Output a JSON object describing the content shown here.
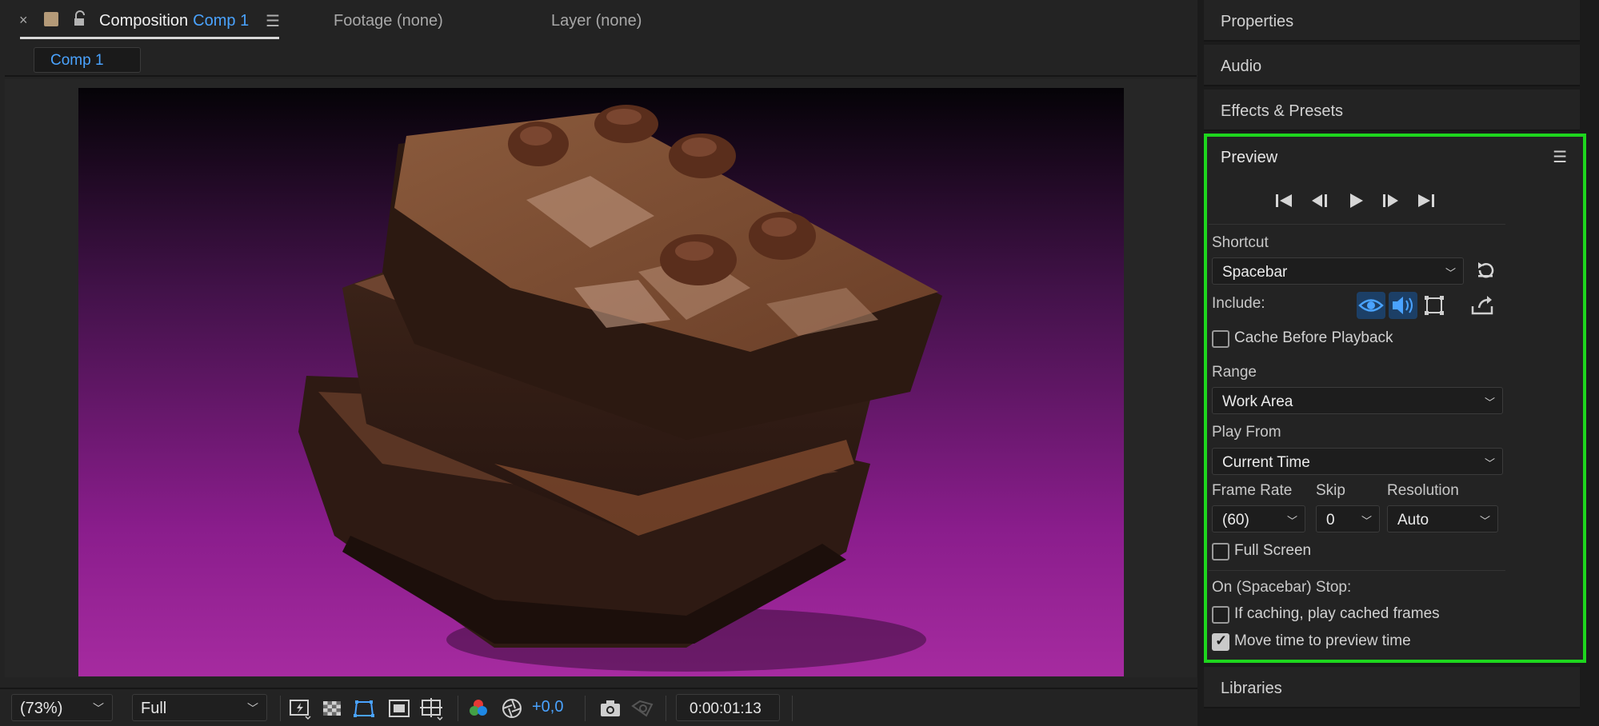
{
  "composition_panel": {
    "tab": {
      "close_glyph": "×",
      "swatch_color": "#b49a78",
      "title_prefix": "Composition",
      "comp_name": "Comp 1",
      "menu_glyph": "☰"
    },
    "footage_tab": "Footage (none)",
    "layer_tab": "Layer (none)",
    "flowchart_chip": "Comp 1",
    "viewer_image": "brownie-stack-on-magenta-background"
  },
  "viewer_toolbar": {
    "zoom": "(73%)",
    "resolution": "Full",
    "exposure": "+0,0",
    "current_time": "0:00:01:13",
    "icons": [
      "fast-previews-icon",
      "transparency-grid-icon",
      "mask-visibility-icon",
      "region-of-interest-icon",
      "grid-guides-icon",
      "color-channels-icon",
      "reset-exposure-icon",
      "snapshot-icon",
      "show-snapshot-icon"
    ]
  },
  "side_panels": {
    "properties": "Properties",
    "audio": "Audio",
    "effects_presets": "Effects & Presets",
    "libraries": "Libraries"
  },
  "preview": {
    "title": "Preview",
    "menu_glyph": "☰",
    "transport": [
      "first-frame-icon",
      "previous-frame-icon",
      "play-icon",
      "next-frame-icon",
      "last-frame-icon"
    ],
    "shortcut_label": "Shortcut",
    "shortcut_value": "Spacebar",
    "include_label": "Include:",
    "cache_before_playback": {
      "label": "Cache Before Playback",
      "checked": false
    },
    "range_label": "Range",
    "range_value": "Work Area",
    "play_from_label": "Play From",
    "play_from_value": "Current Time",
    "frame_rate_label": "Frame Rate",
    "frame_rate_value": "(60)",
    "skip_label": "Skip",
    "skip_value": "0",
    "resolution_label": "Resolution",
    "resolution_value": "Auto",
    "full_screen": {
      "label": "Full Screen",
      "checked": false
    },
    "on_stop_label": "On (Spacebar) Stop:",
    "if_caching": {
      "label": "If caching, play cached frames",
      "checked": false
    },
    "move_time": {
      "label": "Move time to preview time",
      "checked": true
    }
  },
  "colors": {
    "accent_blue": "#4aa3ff",
    "highlight_green": "#1ed61e",
    "panel_bg": "#232323"
  }
}
